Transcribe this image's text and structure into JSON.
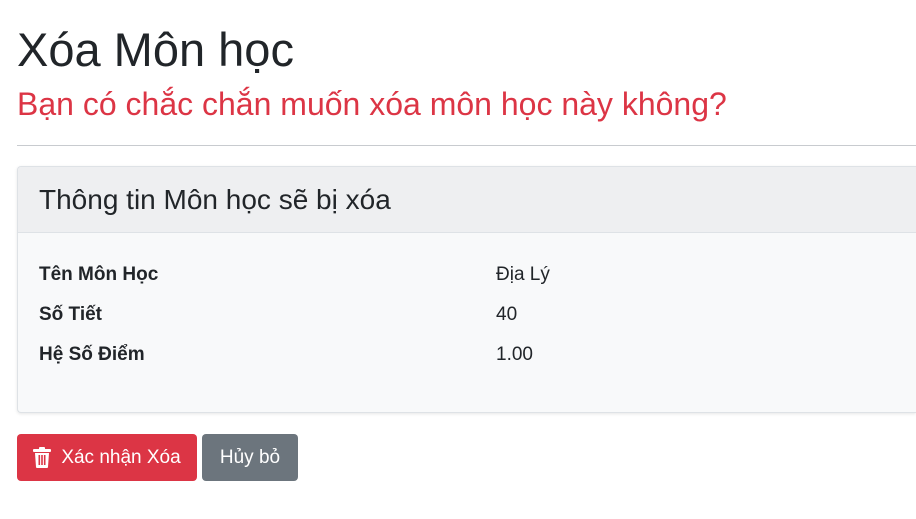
{
  "page": {
    "title": "Xóa Môn học",
    "confirm_question": "Bạn có chắc chắn muốn xóa môn học này không?"
  },
  "card": {
    "header": "Thông tin Môn học sẽ bị xóa",
    "fields": [
      {
        "label": "Tên Môn Học",
        "value": "Địa Lý"
      },
      {
        "label": "Số Tiết",
        "value": "40"
      },
      {
        "label": "Hệ Số Điểm",
        "value": "1.00"
      }
    ]
  },
  "actions": {
    "confirm_delete_label": "Xác nhận Xóa",
    "confirm_delete_icon": "trash-icon",
    "cancel_label": "Hủy bỏ"
  },
  "colors": {
    "danger": "#dc3545",
    "secondary": "#6c757d",
    "text": "#212529"
  }
}
